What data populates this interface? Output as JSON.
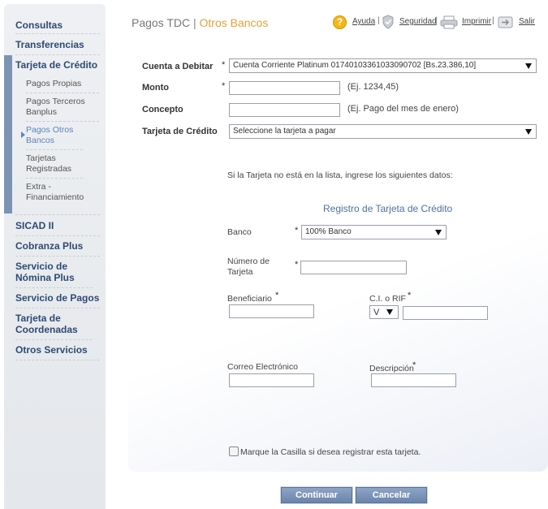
{
  "sidebar": {
    "items": [
      {
        "label": "Consultas"
      },
      {
        "label": "Transferencias"
      },
      {
        "label": "Tarjeta de Crédito"
      },
      {
        "label": "SICAD II"
      },
      {
        "label": "Cobranza Plus"
      },
      {
        "label": "Servicio de Nómina Plus"
      },
      {
        "label": "Servicio de Pagos"
      },
      {
        "label": "Tarjeta de Coordenadas"
      },
      {
        "label": "Otros Servicios"
      }
    ],
    "sub_items": [
      {
        "label": "Pagos Propias"
      },
      {
        "label": "Pagos Terceros Banplus"
      },
      {
        "label": "Pagos Otros Bancos"
      },
      {
        "label": "Tarjetas Registradas"
      },
      {
        "label": "Extra - Financiamiento"
      }
    ]
  },
  "header": {
    "title_primary": "Pagos TDC",
    "title_separator": "|",
    "title_secondary": "Otros Bancos",
    "links": {
      "help": "Ayuda",
      "security": "Seguridad",
      "print": "Imprimir",
      "exit": "Salir"
    },
    "separator": "|"
  },
  "form": {
    "debit_account": {
      "label": "Cuenta a Debitar",
      "value": "Cuenta Corriente Platinum 01740103361033090702 [Bs.23.386,10]"
    },
    "amount": {
      "label": "Monto",
      "value": "",
      "hint": "(Ej. 1234,45)"
    },
    "concept": {
      "label": "Concepto",
      "value": "",
      "hint": "(Ej. Pago del mes de enero)"
    },
    "credit_card": {
      "label": "Tarjeta de Crédito",
      "value": "Seleccione la tarjeta a pagar"
    },
    "required_mark": "*"
  },
  "registration": {
    "info_text": "Si la Tarjeta no está en la lista, ingrese los siguientes datos:",
    "heading": "Registro de Tarjeta de Crédito",
    "bank": {
      "label": "Banco",
      "value": "100% Banco"
    },
    "card_number": {
      "label": "Número de Tarjeta",
      "value": ""
    },
    "beneficiary": {
      "label": "Beneficiario",
      "value": ""
    },
    "id_rif": {
      "label": "C.I. o RIF",
      "prefix": "V",
      "value": ""
    },
    "email": {
      "label": "Correo Electrónico",
      "value": ""
    },
    "description": {
      "label": "Descripción",
      "value": ""
    },
    "save_checkbox_label": "Marque la Casilla si desea registrar esta tarjeta."
  },
  "actions": {
    "continue": "Continuar",
    "cancel": "Cancelar"
  },
  "colors": {
    "accent": "#e2a23a",
    "nav": "#2e4a74",
    "button": "#7d93b4"
  }
}
